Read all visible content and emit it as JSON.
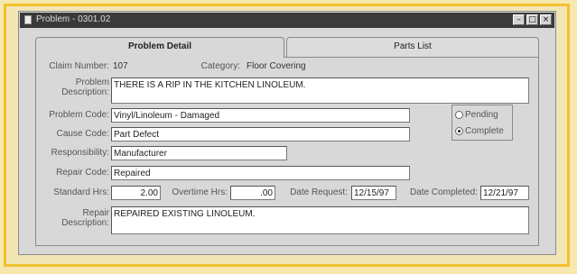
{
  "window": {
    "title": "Problem - 0301.02"
  },
  "tabs": [
    {
      "label": "Problem Detail",
      "active": true
    },
    {
      "label": "Parts List",
      "active": false
    }
  ],
  "form": {
    "claim_number_label": "Claim Number:",
    "claim_number": "107",
    "category_label": "Category:",
    "category": "Floor Covering",
    "problem_description_label": "Problem Description:",
    "problem_description": "THERE IS A RIP IN THE KITCHEN LINOLEUM.",
    "problem_code_label": "Problem Code:",
    "problem_code": "Vinyl/Linoleum - Damaged",
    "cause_code_label": "Cause Code:",
    "cause_code": "Part Defect",
    "responsibility_label": "Responsibility:",
    "responsibility": "Manufacturer",
    "repair_code_label": "Repair Code:",
    "repair_code": "Repaired",
    "standard_hrs_label": "Standard Hrs:",
    "standard_hrs": "2.00",
    "overtime_hrs_label": "Overtime Hrs:",
    "overtime_hrs": ".00",
    "date_request_label": "Date Request:",
    "date_request": "12/15/97",
    "date_completed_label": "Date Completed:",
    "date_completed": "12/21/97",
    "repair_description_label": "Repair Description:",
    "repair_description": "REPAIRED EXISTING LINOLEUM."
  },
  "status": {
    "options": [
      {
        "label": "Pending",
        "selected": false
      },
      {
        "label": "Complete",
        "selected": true
      }
    ]
  },
  "colors": {
    "frame": "#f2c12e",
    "titlebar": "#3a3a3a",
    "window_bg": "#d8d8d8"
  }
}
